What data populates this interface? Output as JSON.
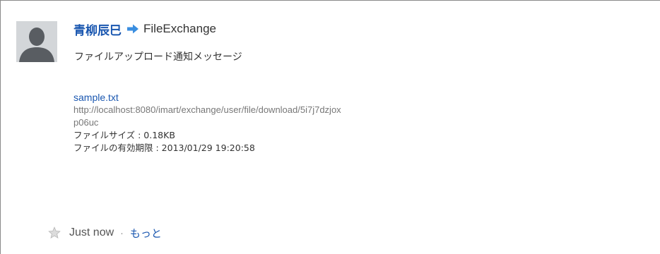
{
  "post": {
    "sender_name": "青柳辰巳",
    "recipient": "FileExchange",
    "message": "ファイルアップロード通知メッセージ",
    "icons": {
      "avatar": "default-user-avatar",
      "arrow": "right-arrow-icon",
      "star": "star-icon"
    },
    "colors": {
      "link": "#1a57b0",
      "arrow": "#3a8ee0",
      "avatar_bg": "#d3d6d9",
      "star": "#c9c9c9"
    }
  },
  "file": {
    "name": "sample.txt",
    "url_line1": "http://localhost:8080/imart/exchange/user/file/download/5i7j7dzjox",
    "url_line2": "p06uc",
    "size_line": "ファイルサイズ : 0.18KB",
    "expiry_line": "ファイルの有効期限 : 2013/01/29 19:20:58"
  },
  "footer": {
    "timestamp": "Just now",
    "separator": "·",
    "more_label": "もっと"
  }
}
